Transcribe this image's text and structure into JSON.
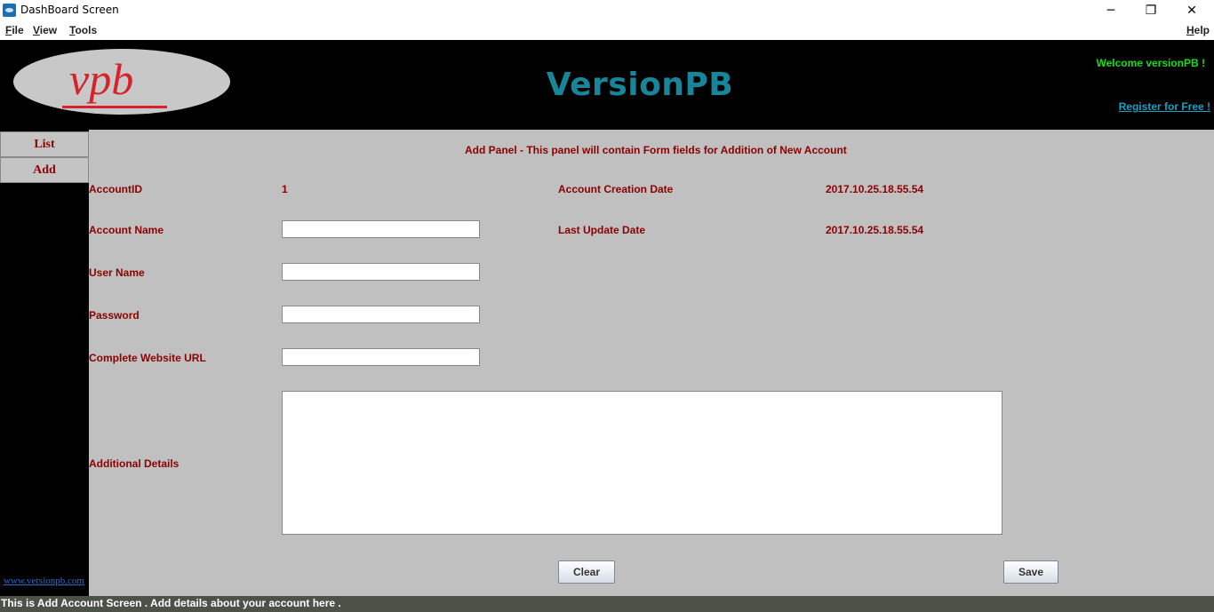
{
  "window": {
    "title": "DashBoard Screen",
    "minimize_glyph": "─",
    "maximize_glyph": "❐",
    "close_glyph": "✕"
  },
  "menu": {
    "file": {
      "accel": "F",
      "rest": "ile"
    },
    "view": {
      "accel": "V",
      "rest": "iew"
    },
    "tools": {
      "accel": "T",
      "rest": "ools"
    },
    "help": {
      "accel": "H",
      "rest": "elp"
    }
  },
  "header": {
    "logo_text": "vpb",
    "app_title": "VersionPB",
    "welcome": "Welcome versionPB !",
    "register_link": "Register for Free !"
  },
  "sidebar": {
    "items": [
      "List",
      "Add"
    ],
    "footer_link": "www.versionpb.com"
  },
  "form": {
    "panel_title": "Add Panel - This panel will contain Form fields for Addition of New Account",
    "account_id_label": "AccountID",
    "account_id_value": "1",
    "creation_date_label": "Account Creation Date",
    "creation_date_value": "2017.10.25.18.55.54",
    "account_name_label": "Account Name",
    "account_name_value": "",
    "last_update_label": "Last Update Date",
    "last_update_value": "2017.10.25.18.55.54",
    "user_name_label": "User Name",
    "user_name_value": "",
    "password_label": "Password",
    "password_value": "",
    "url_label": "Complete Website URL",
    "url_value": "",
    "details_label": "Additional Details",
    "details_value": "",
    "clear_button": "Clear",
    "save_button": "Save"
  },
  "status": {
    "text": "This is Add Account Screen . Add details about your account here ."
  },
  "colors": {
    "header_bg": "#000000",
    "title_color": "#17869a",
    "welcome_color": "#14e014",
    "label_color": "#8b0000",
    "panel_bg": "#c0c0c0"
  }
}
